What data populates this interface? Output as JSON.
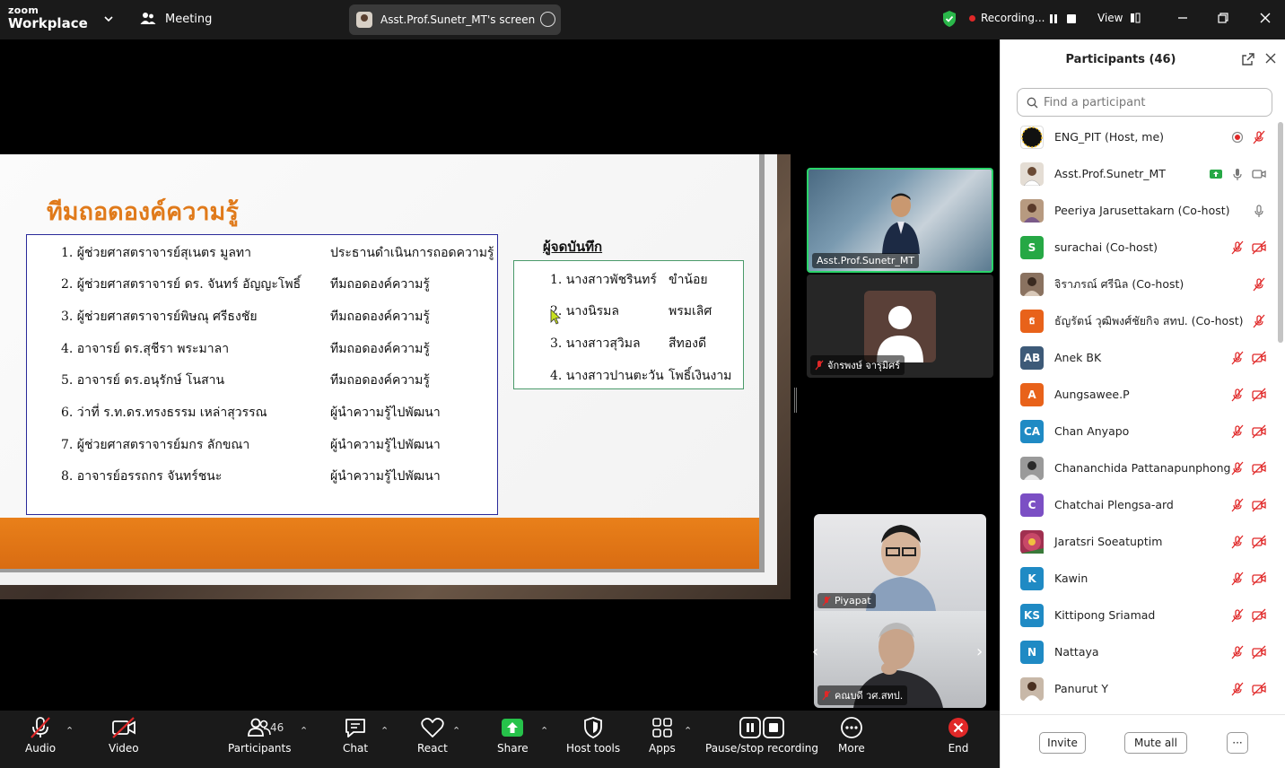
{
  "topbar": {
    "logo_line1": "zoom",
    "logo_line2": "Workplace",
    "meeting_label": "Meeting",
    "screen_label": "Asst.Prof.Sunetr_MT's screen",
    "recording_label": "Recording...",
    "view_label": "View"
  },
  "slide": {
    "title": "ทีมถอดองค์ความรู้",
    "members": [
      {
        "name": "1.  ผู้ช่วยศาสตราจารย์สุเนตร  มูลทา",
        "role": "ประธานดำเนินการถอดความรู้"
      },
      {
        "name": "2.  ผู้ช่วยศาสตราจารย์ ดร.   จันทร์ อัญญะโพธิ์",
        "role": "ทีมถอดองค์ความรู้"
      },
      {
        "name": "3.  ผู้ช่วยศาสตราจารย์พิษณุ  ศรีธงชัย",
        "role": "ทีมถอดองค์ความรู้"
      },
      {
        "name": "4.  อาจารย์ ดร.สุชีรา  พระมาลา",
        "role": "ทีมถอดองค์ความรู้"
      },
      {
        "name": "5.  อาจารย์ ดร.อนุรักษ์  โนสาน",
        "role": "ทีมถอดองค์ความรู้"
      },
      {
        "name": "6.  ว่าที่ ร.ท.ดร.ทรงธรรม  เหล่าสุวรรณ",
        "role": "ผู้นำความรู้ไปพัฒนา"
      },
      {
        "name": "7.  ผู้ช่วยศาสตราจารย์มกร  ลักขณา",
        "role": "ผู้นำความรู้ไปพัฒนา"
      },
      {
        "name": "8.  อาจารย์อรรถกร  จันทร์ชนะ",
        "role": "ผู้นำความรู้ไปพัฒนา"
      }
    ],
    "recorders_title": "ผู้จดบันทึก",
    "recorders": [
      {
        "name": "1. นางสาวพัชรินทร์",
        "surname": "ขำน้อย"
      },
      {
        "name": "2. นางนิรมล",
        "surname": "พรมเลิศ"
      },
      {
        "name": "3. นางสาวสุวิมล",
        "surname": "สีทองดี"
      },
      {
        "name": "4.  นางสาวปานตะวัน",
        "surname": "โพธิ์เงินงาม"
      }
    ]
  },
  "thumbnails": {
    "t1": "Asst.Prof.Sunetr_MT",
    "t2": "จักรพงษ์ จารุมิศร์",
    "t3": "Piyapat",
    "t4": "คณบดี วศ.สทป."
  },
  "panel": {
    "title": "Participants (46)",
    "search_placeholder": "Find a participant",
    "invite_label": "Invite",
    "mute_all_label": "Mute all",
    "more_label": "···",
    "participants": [
      {
        "name": "ENG_PIT (Host, me)",
        "initials": "",
        "color": "#111111"
      },
      {
        "name": "Asst.Prof.Sunetr_MT",
        "initials": "",
        "color": "#d9cfc4"
      },
      {
        "name": "Peeriya Jarusettakarn (Co-host)",
        "initials": "",
        "color": "#b79a80"
      },
      {
        "name": "surachai (Co-host)",
        "initials": "S",
        "color": "#26a845"
      },
      {
        "name": "จิราภรณ์ ศรีนิล (Co-host)",
        "initials": "",
        "color": "#8a7260"
      },
      {
        "name": "ธัญรัตน์ วุฒิพงศ์ชัยกิจ สทป. (Co-host)",
        "initials": "ธ",
        "color": "#e8621a"
      },
      {
        "name": "Anek BK",
        "initials": "AB",
        "color": "#3d5a78"
      },
      {
        "name": "Aungsawee.P",
        "initials": "A",
        "color": "#e8621a"
      },
      {
        "name": "Chan Anyapo",
        "initials": "CA",
        "color": "#1f8ac4"
      },
      {
        "name": "Chananchida Pattanapunphong",
        "initials": "",
        "color": "#9a9a9a"
      },
      {
        "name": "Chatchai Plengsa-ard",
        "initials": "C",
        "color": "#7b4fc4"
      },
      {
        "name": "Jaratsri Soeatuptim",
        "initials": "",
        "color": "#a03050"
      },
      {
        "name": "Kawin",
        "initials": "K",
        "color": "#1f8ac4"
      },
      {
        "name": "Kittipong Sriamad",
        "initials": "KS",
        "color": "#1f8ac4"
      },
      {
        "name": "Nattaya",
        "initials": "N",
        "color": "#1f8ac4"
      },
      {
        "name": "Panurut Y",
        "initials": "",
        "color": "#c8b8a8"
      }
    ]
  },
  "toolbar": {
    "audio": "Audio",
    "video": "Video",
    "participants": "Participants",
    "participants_count": "46",
    "chat": "Chat",
    "react": "React",
    "share": "Share",
    "host_tools": "Host tools",
    "apps": "Apps",
    "recording": "Pause/stop recording",
    "more": "More",
    "end": "End"
  }
}
